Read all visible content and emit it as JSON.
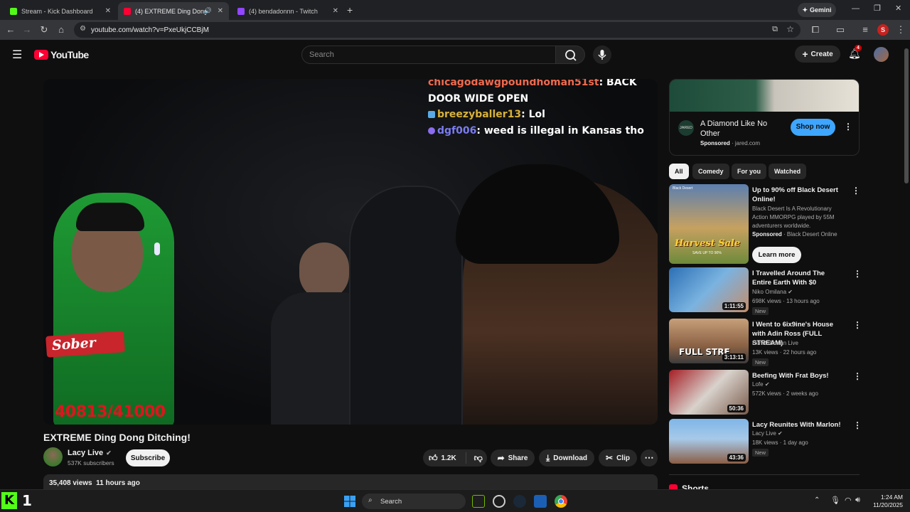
{
  "browser": {
    "tabs": [
      {
        "title": "Stream - Kick Dashboard",
        "favicon_color": "#53fc18"
      },
      {
        "title": "(4) EXTREME Ding Dong Di...",
        "favicon_color": "#ff0033"
      },
      {
        "title": "(4) bendadonnn - Twitch",
        "favicon_color": "#9146ff"
      }
    ],
    "gemini_label": "Gemini",
    "url": "youtube.com/watch?v=PxeUkjCCBjM",
    "profile_initial": "S"
  },
  "youtube": {
    "logo_text": "YouTube",
    "search_placeholder": "Search",
    "create_label": "Create",
    "notification_count": "4"
  },
  "video": {
    "chat": [
      {
        "user": "chicagodawgpoundhoman51st",
        "user_color": "#f06a4e",
        "message": ": BACK",
        "continuation": "DOOR WIDE OPEN"
      },
      {
        "user": "breezyballer13",
        "user_color": "#d8b23a",
        "message": ": Lol"
      },
      {
        "user": "dgf006",
        "user_color": "#7a7cf0",
        "message": ": weed is illegal in Kansas tho"
      }
    ],
    "counter": "40813/41000",
    "shirt_text": "Sober"
  },
  "meta": {
    "title": "EXTREME Ding Dong Ditching!",
    "channel": "Lacy Live",
    "subscribers": "537K subscribers",
    "subscribe_label": "Subscribe",
    "likes": "1.2K",
    "share_label": "Share",
    "download_label": "Download",
    "clip_label": "Clip",
    "views": "35,408 views",
    "age": "11 hours ago"
  },
  "ad": {
    "logo_text": "JARED",
    "title": "A Diamond Like No Other",
    "sponsored": "Sponsored",
    "domain": "jared.com",
    "cta": "Shop now"
  },
  "chips": [
    "All",
    "Comedy",
    "For you",
    "Watched"
  ],
  "recommendations": [
    {
      "title": "Up to 90% off Black Desert Online!",
      "desc": "Black Desert Is A Revolutionary Action MMORPG played by 55M adventurers worldwide.",
      "sponsored": "Sponsored",
      "channel": "Black Desert Online",
      "cta": "Learn more",
      "thumb_text": "Harvest Sale",
      "thumb_sub": "SAVE UP TO 90%",
      "thumb_brand": "Black Desert"
    },
    {
      "title": "I Travelled Around The Entire Earth With $0",
      "channel": "Niko Omilana",
      "views": "698K views",
      "age": "13 hours ago",
      "duration": "1:11:55",
      "badge": "New"
    },
    {
      "title": "I Went to 6ix9ine's House with Adin Ross (FULL STREAM)",
      "channel": "BenDaDonnn Live",
      "views": "13K views",
      "age": "22 hours ago",
      "duration": "3:13:11",
      "badge": "New",
      "thumb_text": "FULL STRE"
    },
    {
      "title": "Beefing With Frat Boys!",
      "channel": "Lofe",
      "views": "572K views",
      "age": "2 weeks ago",
      "duration": "50:36"
    },
    {
      "title": "Lacy Reunites With Marlon!",
      "channel": "Lacy Live",
      "views": "18K views",
      "age": "1 day ago",
      "duration": "43:36",
      "badge": "New"
    }
  ],
  "shorts_label": "Shorts",
  "taskbar": {
    "kick_count": "1",
    "search_label": "Search",
    "time": "1:24 AM",
    "date": "11/20/2025"
  }
}
